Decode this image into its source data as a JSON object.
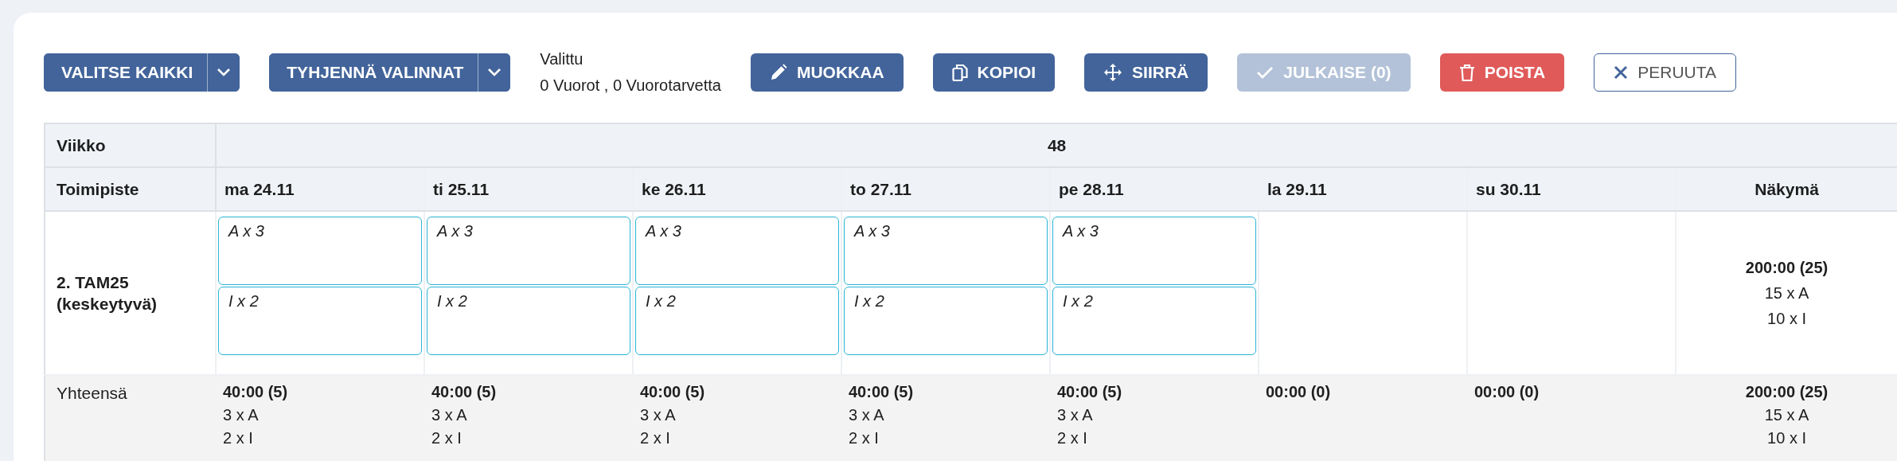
{
  "toolbar": {
    "buttons": [
      {
        "kind": "split",
        "label": "VALITSE KAIKKI",
        "disabled": false
      },
      {
        "kind": "split",
        "label": "TYHJENNÄ VALINNAT",
        "disabled": false
      }
    ],
    "selection": {
      "label": "Valittu",
      "summary": "0 Vuorot , 0 Vuorotarvetta"
    },
    "actions": [
      {
        "kind": "edit",
        "label": "MUOKKAA",
        "disabled": false
      },
      {
        "kind": "copy",
        "label": "KOPIOI",
        "disabled": false
      },
      {
        "kind": "move",
        "label": "SIIRRÄ",
        "disabled": false
      },
      {
        "kind": "publish",
        "label": "JULKAISE (0)",
        "disabled": true
      },
      {
        "kind": "delete",
        "label": "POISTA",
        "disabled": false
      },
      {
        "kind": "cancel",
        "label": "PERUUTA",
        "disabled": false
      }
    ]
  },
  "table": {
    "week_row": {
      "label": "Viikko",
      "week": "48"
    },
    "header": {
      "label": "Toimipiste",
      "days": [
        "ma 24.11",
        "ti 25.11",
        "ke 26.11",
        "to 27.11",
        "pe 28.11",
        "la 29.11",
        "su 30.11"
      ],
      "summary": "Näkymä"
    },
    "rows": [
      {
        "location": "2. TAM25 (keskeytyvä)",
        "days": [
          {
            "kind": "shifts",
            "shifts": [
              "A x 3",
              "I x 2"
            ]
          },
          {
            "kind": "shifts",
            "shifts": [
              "A x 3",
              "I x 2"
            ]
          },
          {
            "kind": "shifts",
            "shifts": [
              "A x 3",
              "I x 2"
            ]
          },
          {
            "kind": "shifts",
            "shifts": [
              "A x 3",
              "I x 2"
            ]
          },
          {
            "kind": "shifts",
            "shifts": [
              "A x 3",
              "I x 2"
            ]
          },
          {
            "kind": "empty"
          },
          {
            "kind": "empty"
          }
        ],
        "summary": {
          "total": "200:00 (25)",
          "lines": [
            "15 x A",
            "10 x I"
          ]
        }
      }
    ],
    "totals": {
      "label": "Yhteensä",
      "days": [
        {
          "total": "40:00 (5)",
          "lines": [
            "3 x A",
            "2 x I"
          ]
        },
        {
          "total": "40:00 (5)",
          "lines": [
            "3 x A",
            "2 x I"
          ]
        },
        {
          "total": "40:00 (5)",
          "lines": [
            "3 x A",
            "2 x I"
          ]
        },
        {
          "total": "40:00 (5)",
          "lines": [
            "3 x A",
            "2 x I"
          ]
        },
        {
          "total": "40:00 (5)",
          "lines": [
            "3 x A",
            "2 x I"
          ]
        },
        {
          "total": "00:00 (0)"
        },
        {
          "total": "00:00 (0)"
        }
      ],
      "summary": {
        "total": "200:00 (25)",
        "lines": [
          "15 x A",
          "10 x I"
        ]
      }
    }
  }
}
